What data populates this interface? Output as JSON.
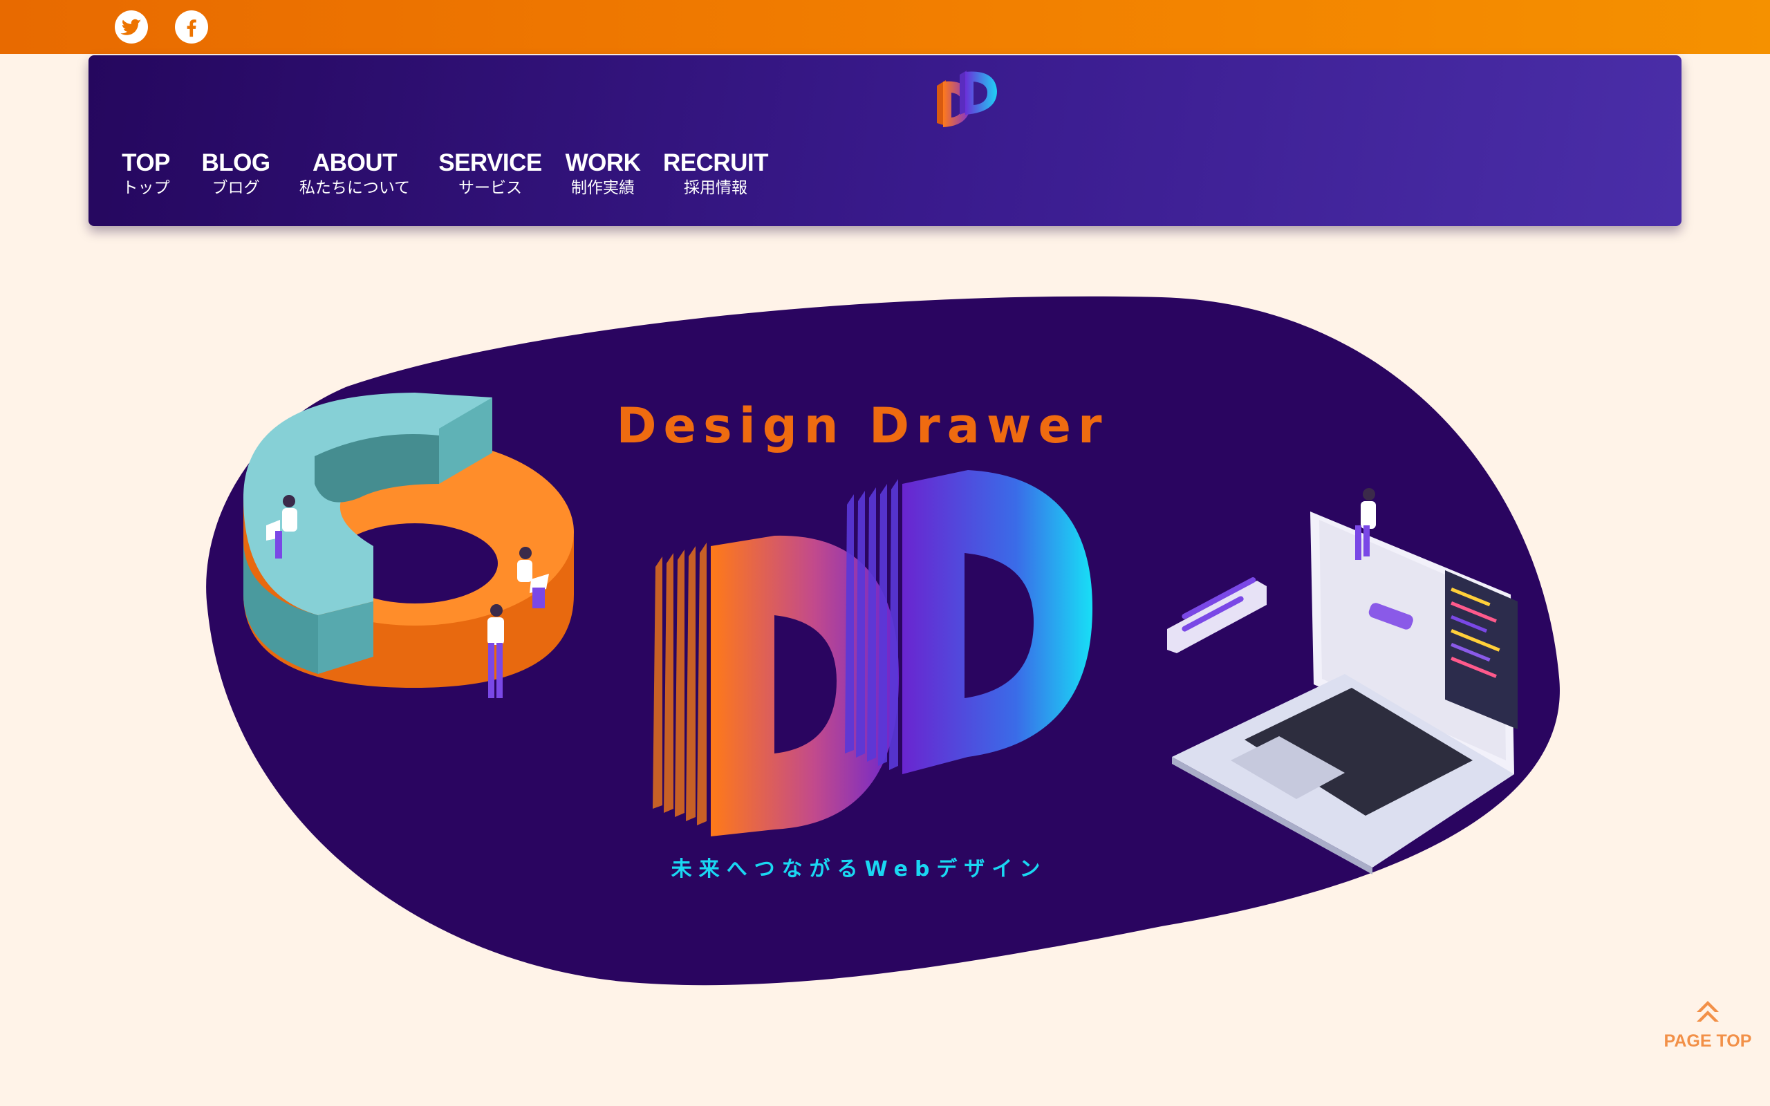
{
  "social": {
    "twitter": "twitter-icon",
    "facebook": "facebook-icon"
  },
  "nav": {
    "items": [
      {
        "en": "TOP",
        "jp": "トップ"
      },
      {
        "en": "BLOG",
        "jp": "ブログ"
      },
      {
        "en": "ABOUT",
        "jp": "私たちについて"
      },
      {
        "en": "SERVICE",
        "jp": "サービス"
      },
      {
        "en": "WORK",
        "jp": "制作実績"
      },
      {
        "en": "RECRUIT",
        "jp": "採用情報"
      }
    ]
  },
  "hero": {
    "title": "Design Drawer",
    "subtitle": "未来へつながるWebデザイン"
  },
  "page_top": {
    "label": "PAGE TOP",
    "icon": "double-chevron-up-icon"
  },
  "colors": {
    "topbar": "#f27f00",
    "header": "#2b0d6e",
    "blob": "#2a0560",
    "title": "#ef6b10",
    "subtitle": "#1ad7f2",
    "background": "#fff3e8"
  }
}
